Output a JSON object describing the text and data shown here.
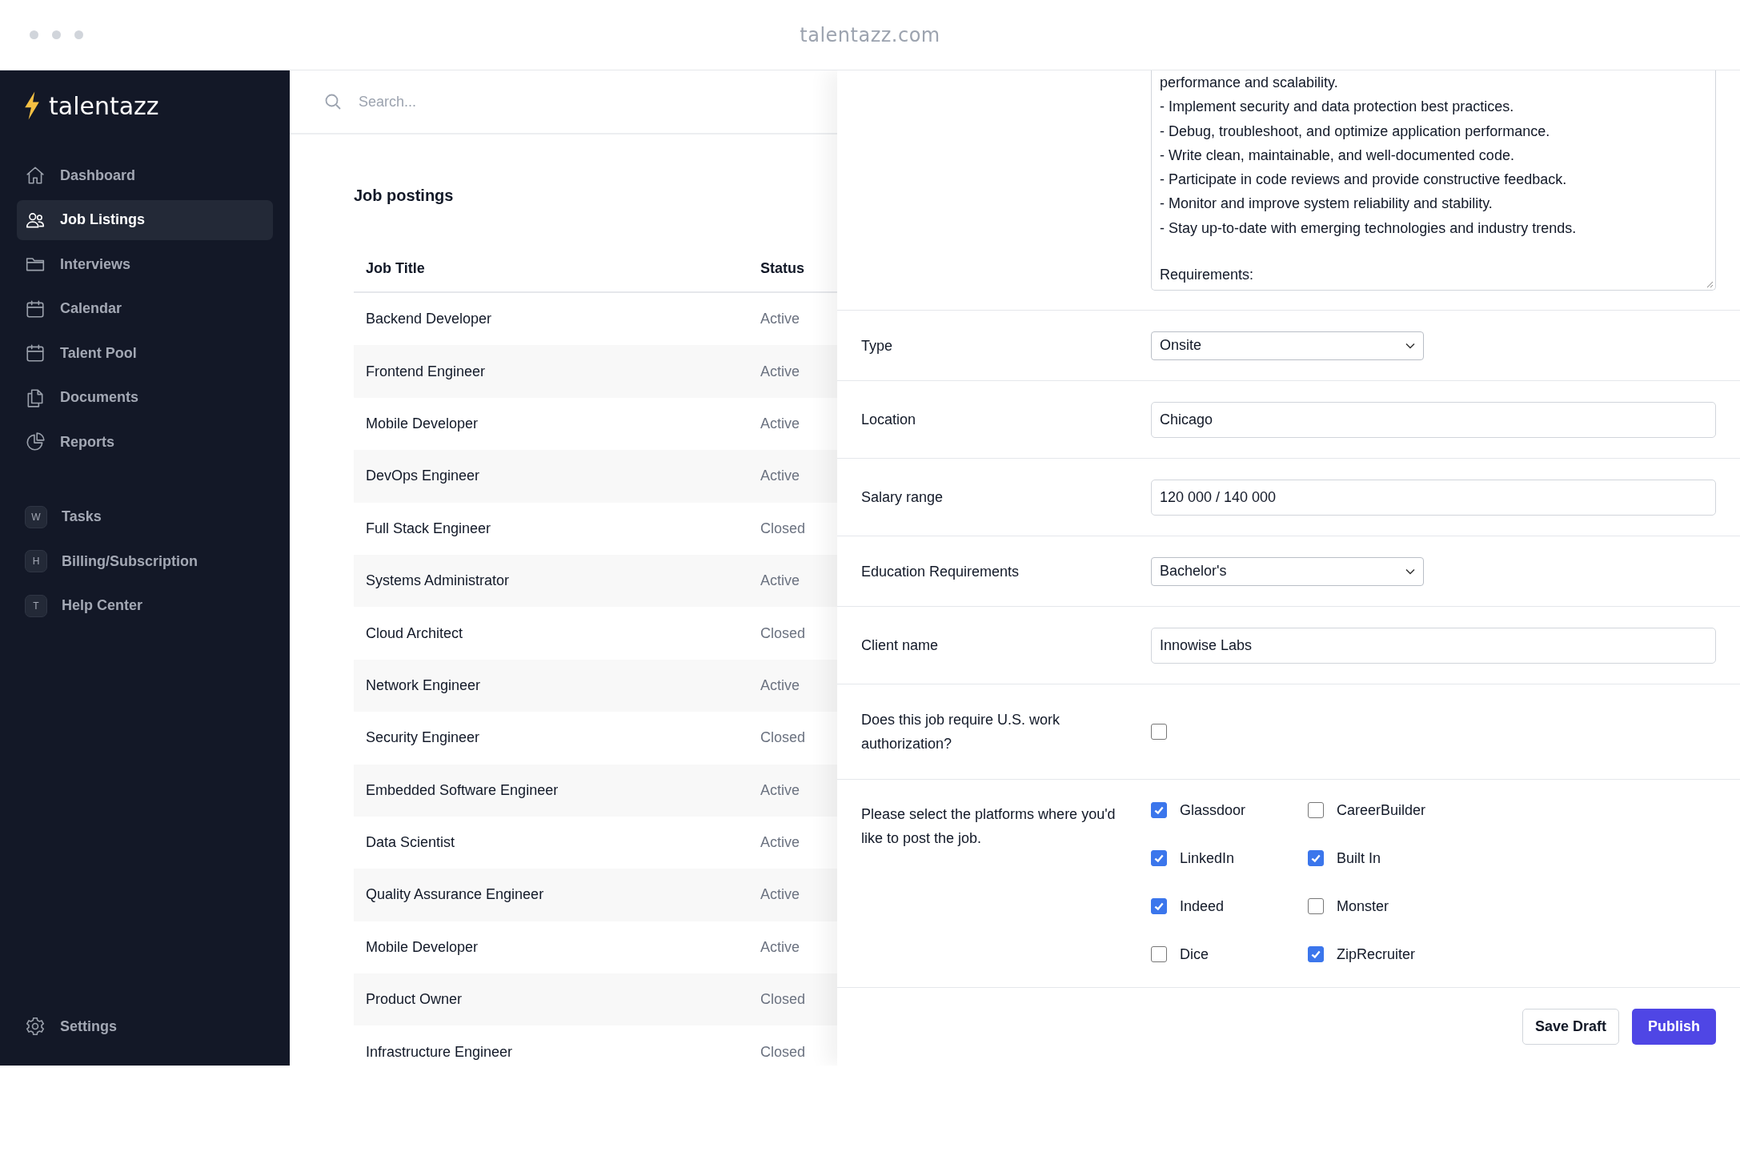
{
  "browser": {
    "url": "talentazz.com"
  },
  "sidebar": {
    "logo": "talentazz",
    "items": [
      {
        "label": "Dashboard",
        "selected": false
      },
      {
        "label": "Job Listings",
        "selected": true
      },
      {
        "label": "Interviews",
        "selected": false
      },
      {
        "label": "Calendar",
        "selected": false
      },
      {
        "label": "Talent Pool",
        "selected": false
      },
      {
        "label": "Documents",
        "selected": false
      },
      {
        "label": "Reports",
        "selected": false
      }
    ],
    "workspace_items": [
      {
        "letter": "W",
        "label": "Tasks"
      },
      {
        "letter": "H",
        "label": "Billing/Subscription"
      },
      {
        "letter": "T",
        "label": "Help Center"
      }
    ],
    "settings": "Settings"
  },
  "search": {
    "placeholder": "Search..."
  },
  "job_postings": {
    "title": "Job postings",
    "columns": [
      "Job Title",
      "Status"
    ],
    "rows": [
      {
        "title": "Backend Developer",
        "status": "Active"
      },
      {
        "title": "Frontend Engineer",
        "status": "Active"
      },
      {
        "title": "Mobile Developer",
        "status": "Active"
      },
      {
        "title": "DevOps Engineer",
        "status": "Active"
      },
      {
        "title": "Full Stack Engineer",
        "status": "Closed"
      },
      {
        "title": "Systems Administrator",
        "status": "Active"
      },
      {
        "title": "Cloud Architect",
        "status": "Closed"
      },
      {
        "title": "Network Engineer",
        "status": "Active"
      },
      {
        "title": "Security Engineer",
        "status": "Closed"
      },
      {
        "title": "Embedded Software Engineer",
        "status": "Active"
      },
      {
        "title": "Data Scientist",
        "status": "Active"
      },
      {
        "title": "Quality Assurance Engineer",
        "status": "Active"
      },
      {
        "title": "Mobile Developer",
        "status": "Active"
      },
      {
        "title": "Product Owner",
        "status": "Closed"
      },
      {
        "title": "Infrastructure Engineer",
        "status": "Closed"
      }
    ]
  },
  "form": {
    "rows": [
      {
        "kind": "textarea",
        "lines": [
          "performance and scalability.",
          "- Implement security and data protection best practices.",
          "- Debug, troubleshoot, and optimize application performance.",
          "- Write clean, maintainable, and well-documented code.",
          "- Participate in code reviews and provide constructive feedback.",
          "- Monitor and improve system reliability and stability.",
          "- Stay up-to-date with emerging technologies and industry trends."
        ],
        "next_section": "Requirements:"
      },
      {
        "kind": "select",
        "label": "Type",
        "value": "Onsite"
      },
      {
        "kind": "text",
        "label": "Location",
        "value": "Chicago"
      },
      {
        "kind": "text",
        "label": "Salary range",
        "value": "120 000 / 140 000"
      },
      {
        "kind": "select",
        "label": "Education Requirements",
        "value": "Bachelor's"
      },
      {
        "kind": "text",
        "label": "Client name",
        "value": "Innowise Labs"
      },
      {
        "kind": "checkbox",
        "label": "Does this job require U.S. work authorization?",
        "checked": false
      },
      {
        "kind": "checkbox_group",
        "label": "Please select the platforms where you'd like to post the job.",
        "options": [
          {
            "label": "Glassdoor",
            "checked": true
          },
          {
            "label": "CareerBuilder",
            "checked": false
          },
          {
            "label": "LinkedIn",
            "checked": true
          },
          {
            "label": "Built In",
            "checked": true
          },
          {
            "label": "Indeed",
            "checked": true
          },
          {
            "label": "Monster",
            "checked": false
          },
          {
            "label": "Dice",
            "checked": false
          },
          {
            "label": "ZipRecruiter",
            "checked": true
          }
        ]
      }
    ],
    "buttons": [
      {
        "label": "Save Draft",
        "kind": "secondary"
      },
      {
        "label": "Publish",
        "kind": "primary"
      }
    ]
  }
}
